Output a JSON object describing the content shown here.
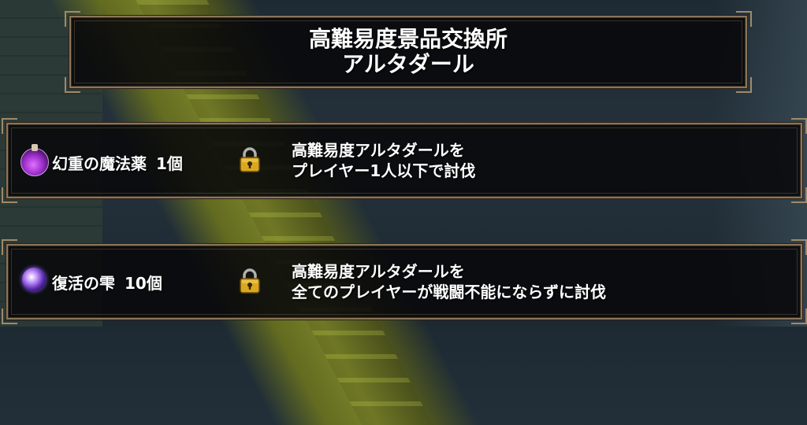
{
  "header": {
    "title_line1": "高難易度景品交換所",
    "title_line2": "アルタダール"
  },
  "rewards": [
    {
      "icon": "potion-icon",
      "item": "幻重の魔法薬",
      "quantity": "1個",
      "status_icon": "lock-icon",
      "condition_line1": "高難易度アルタダールを",
      "condition_line2": "プレイヤー1人以下で討伐"
    },
    {
      "icon": "orb-icon",
      "item": "復活の雫",
      "quantity": "10個",
      "status_icon": "lock-icon",
      "condition_line1": "高難易度アルタダールを",
      "condition_line2": "全てのプレイヤーが戦闘不能にならずに討伐"
    }
  ],
  "colors": {
    "frame": "#8c7659",
    "panel_bg": "#08080a",
    "text": "#ffffff"
  }
}
